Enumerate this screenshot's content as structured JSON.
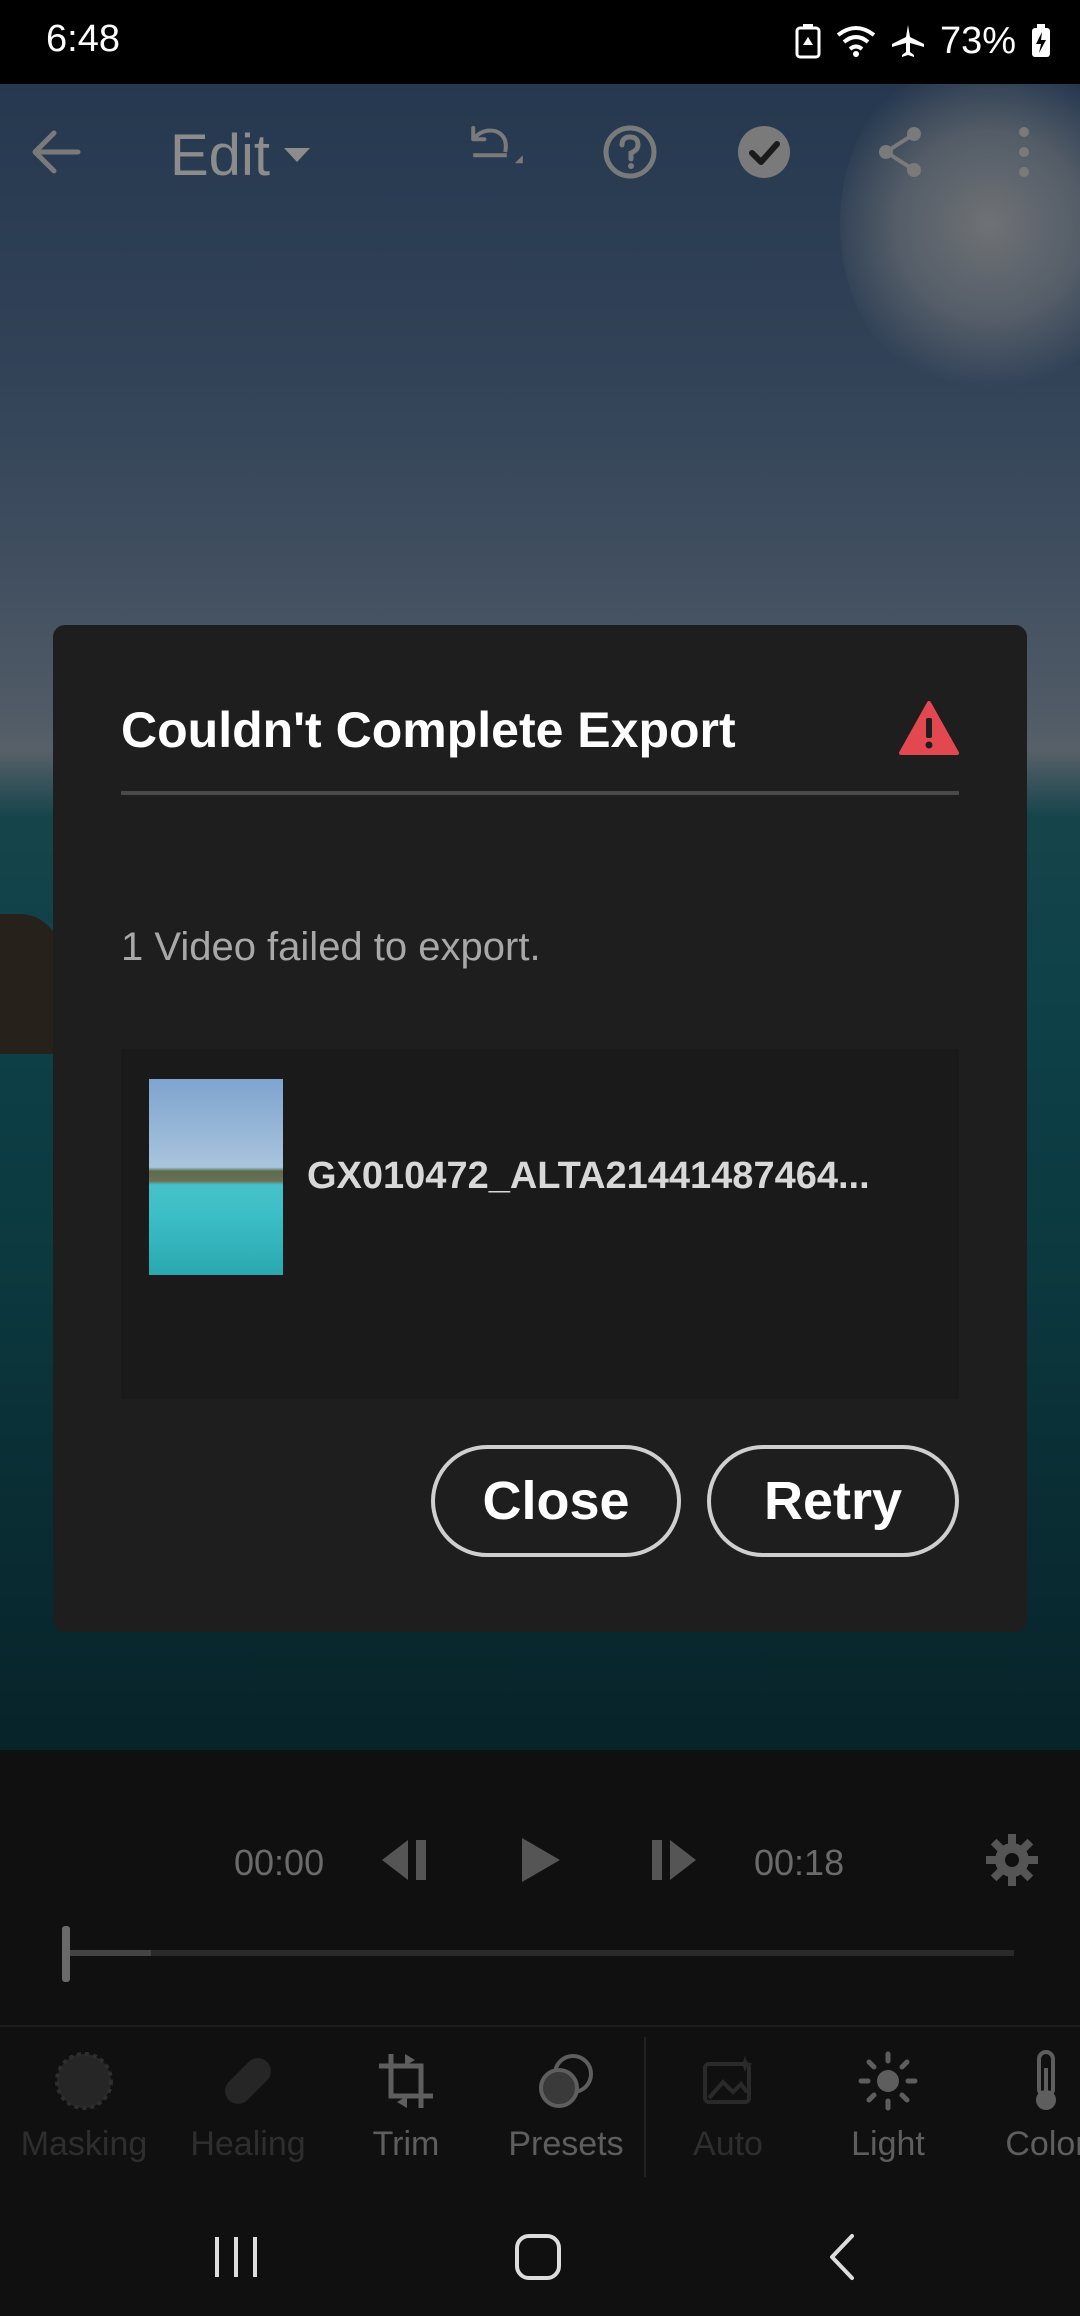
{
  "status_bar": {
    "time": "6:48",
    "battery": "73%",
    "icons": [
      "battery-saver-icon",
      "wifi-icon",
      "airplane-icon",
      "battery-icon"
    ]
  },
  "toolbar": {
    "edit_label": "Edit",
    "icons": [
      "back-arrow-icon",
      "undo-icon",
      "help-icon",
      "done-check-icon",
      "share-icon",
      "more-icon"
    ]
  },
  "dialog": {
    "title": "Couldn't Complete Export",
    "message": "1 Video failed to export.",
    "file_name": "GX010472_ALTA21441487464...",
    "close_label": "Close",
    "retry_label": "Retry",
    "warning_color": "#e34850"
  },
  "player": {
    "current_time": "00:00",
    "duration": "00:18",
    "progress_fraction": 0.09
  },
  "tools": [
    {
      "label": "Masking",
      "icon": "masking-icon",
      "state": "disabled"
    },
    {
      "label": "Healing",
      "icon": "healing-icon",
      "state": "disabled"
    },
    {
      "label": "Trim",
      "icon": "trim-icon",
      "state": "enabled"
    },
    {
      "label": "Presets",
      "icon": "presets-icon",
      "state": "enabled"
    },
    {
      "label": "Auto",
      "icon": "auto-icon",
      "state": "disabled"
    },
    {
      "label": "Light",
      "icon": "light-icon",
      "state": "enabled"
    },
    {
      "label": "Color",
      "icon": "color-icon",
      "state": "enabled"
    }
  ],
  "nav": [
    "recents-icon",
    "home-icon",
    "back-icon"
  ]
}
